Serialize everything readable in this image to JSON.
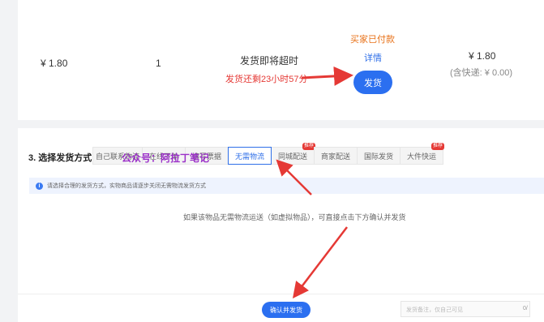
{
  "order": {
    "unit_price": "¥ 1.80",
    "quantity": "1",
    "ship_status": "发货即将超时",
    "order_status": "买家已付款",
    "detail_link": "详情",
    "ship_button": "发货",
    "total": "¥ 1.80",
    "shipping_note": "(含快递: ¥ 0.00)",
    "remaining_note": "发货还剩23小时57分"
  },
  "shipping": {
    "section_title": "3. 选择发货方式",
    "tabs": [
      {
        "label": "自己联系物流",
        "active": false,
        "badge": ""
      },
      {
        "label": "在线下单",
        "active": false,
        "badge": ""
      },
      {
        "label": "填写票据",
        "active": false,
        "badge": ""
      },
      {
        "label": "无需物流",
        "active": true,
        "badge": ""
      },
      {
        "label": "同城配送",
        "active": false,
        "badge": "推荐"
      },
      {
        "label": "商家配送",
        "active": false,
        "badge": ""
      },
      {
        "label": "国际发货",
        "active": false,
        "badge": ""
      },
      {
        "label": "大件快运",
        "active": false,
        "badge": "推荐"
      }
    ],
    "info_text": "请选择合理的发货方式，实物商品请逐步关闭无需物流发货方式",
    "center_message": "如果该物品无需物流运送（如虚拟物品），可直接点击下方确认并发货",
    "watermark": "公众号：阿拉丁笔记"
  },
  "footer": {
    "confirm_button": "确认并发货",
    "remark_placeholder": "发货备注，仅自己可见",
    "remark_count": "0/"
  },
  "colors": {
    "accent_blue": "#2b6ff0",
    "arrow_red": "#e53935",
    "status_orange": "#e8731b",
    "watermark_purple": "#9b30c8"
  }
}
